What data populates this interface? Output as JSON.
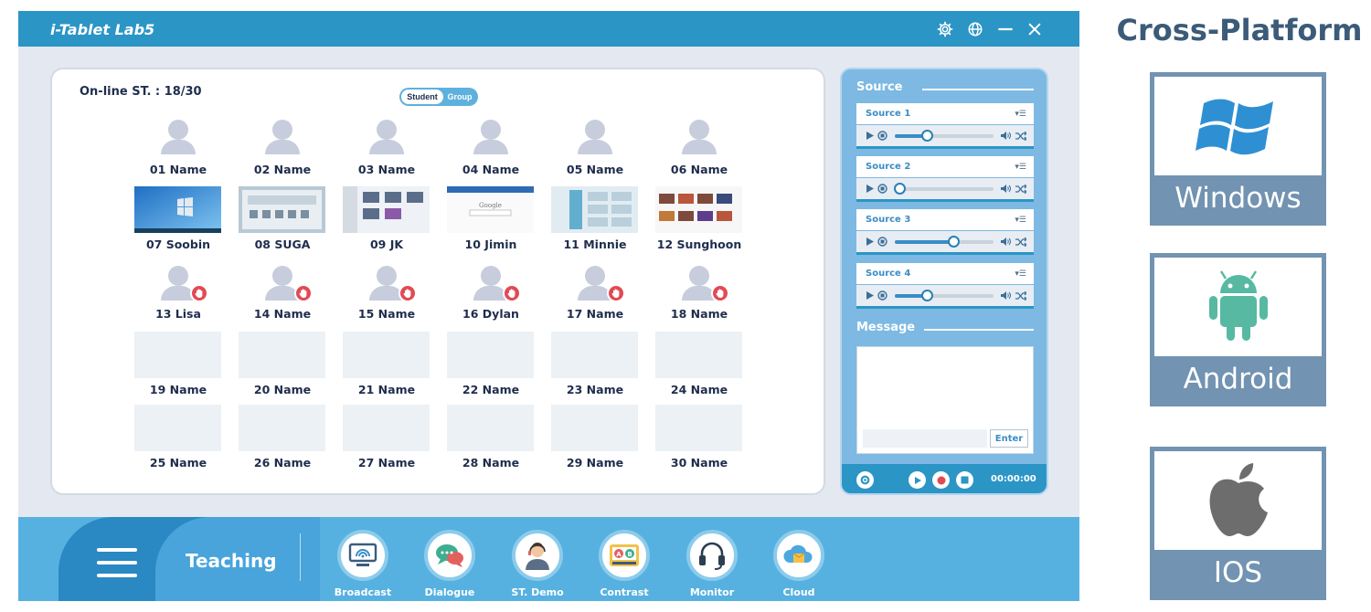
{
  "app": {
    "title": "i-Tablet Lab5"
  },
  "students": {
    "online_label": "On-line ST. : 18/30",
    "toggle": {
      "active": "Student",
      "inactive": "Group"
    },
    "tiles": [
      {
        "name": "01 Name",
        "state": "avatar"
      },
      {
        "name": "02 Name",
        "state": "avatar"
      },
      {
        "name": "03 Name",
        "state": "avatar"
      },
      {
        "name": "04 Name",
        "state": "avatar"
      },
      {
        "name": "05 Name",
        "state": "avatar"
      },
      {
        "name": "06 Name",
        "state": "avatar"
      },
      {
        "name": "07 Soobin",
        "state": "screen",
        "screen": "windows-desktop"
      },
      {
        "name": "08 SUGA",
        "state": "screen",
        "screen": "app-grid"
      },
      {
        "name": "09 JK",
        "state": "screen",
        "screen": "file-browser"
      },
      {
        "name": "10 Jimin",
        "state": "screen",
        "screen": "search-page"
      },
      {
        "name": "11 Minnie",
        "state": "screen",
        "screen": "settings-tiles"
      },
      {
        "name": "12 Sunghoon",
        "state": "screen",
        "screen": "video-grid"
      },
      {
        "name": "13 Lisa",
        "state": "hand"
      },
      {
        "name": "14 Name",
        "state": "hand"
      },
      {
        "name": "15 Name",
        "state": "hand"
      },
      {
        "name": "16 Dylan",
        "state": "hand"
      },
      {
        "name": "17 Name",
        "state": "hand"
      },
      {
        "name": "18 Name",
        "state": "hand"
      },
      {
        "name": "19 Name",
        "state": "empty"
      },
      {
        "name": "20 Name",
        "state": "empty"
      },
      {
        "name": "21 Name",
        "state": "empty"
      },
      {
        "name": "22 Name",
        "state": "empty"
      },
      {
        "name": "23 Name",
        "state": "empty"
      },
      {
        "name": "24 Name",
        "state": "empty"
      },
      {
        "name": "25 Name",
        "state": "empty"
      },
      {
        "name": "26 Name",
        "state": "empty"
      },
      {
        "name": "27 Name",
        "state": "empty"
      },
      {
        "name": "28 Name",
        "state": "empty"
      },
      {
        "name": "29 Name",
        "state": "empty"
      },
      {
        "name": "30 Name",
        "state": "empty"
      }
    ]
  },
  "source": {
    "heading": "Source",
    "items": [
      {
        "name": "Source 1",
        "level": 0.32
      },
      {
        "name": "Source 2",
        "level": 0.05
      },
      {
        "name": "Source 3",
        "level": 0.59
      },
      {
        "name": "Source 4",
        "level": 0.32
      }
    ]
  },
  "message": {
    "heading": "Message",
    "enter_label": "Enter"
  },
  "recorder": {
    "time": "00:00:00"
  },
  "toolbar": {
    "section_label": "Teaching",
    "tools": [
      {
        "label": "Broadcast",
        "icon": "broadcast-icon"
      },
      {
        "label": "Dialogue",
        "icon": "dialogue-icon"
      },
      {
        "label": "ST. Demo",
        "icon": "student-demo-icon"
      },
      {
        "label": "Contrast",
        "icon": "contrast-icon"
      },
      {
        "label": "Monitor",
        "icon": "monitor-headset-icon"
      },
      {
        "label": "Cloud",
        "icon": "cloud-icon"
      }
    ]
  },
  "platforms": {
    "title": "Cross-Platform",
    "items": [
      {
        "label": "Windows",
        "icon": "windows-logo"
      },
      {
        "label": "Android",
        "icon": "android-logo"
      },
      {
        "label": "IOS",
        "icon": "apple-logo"
      }
    ]
  },
  "colors": {
    "titlebar": "#2b95c6",
    "toolbar": "#56b1e0",
    "raise_hand": "#e14a55",
    "text_dark": "#1f2d4d",
    "platform_frame": "#7293b1"
  }
}
